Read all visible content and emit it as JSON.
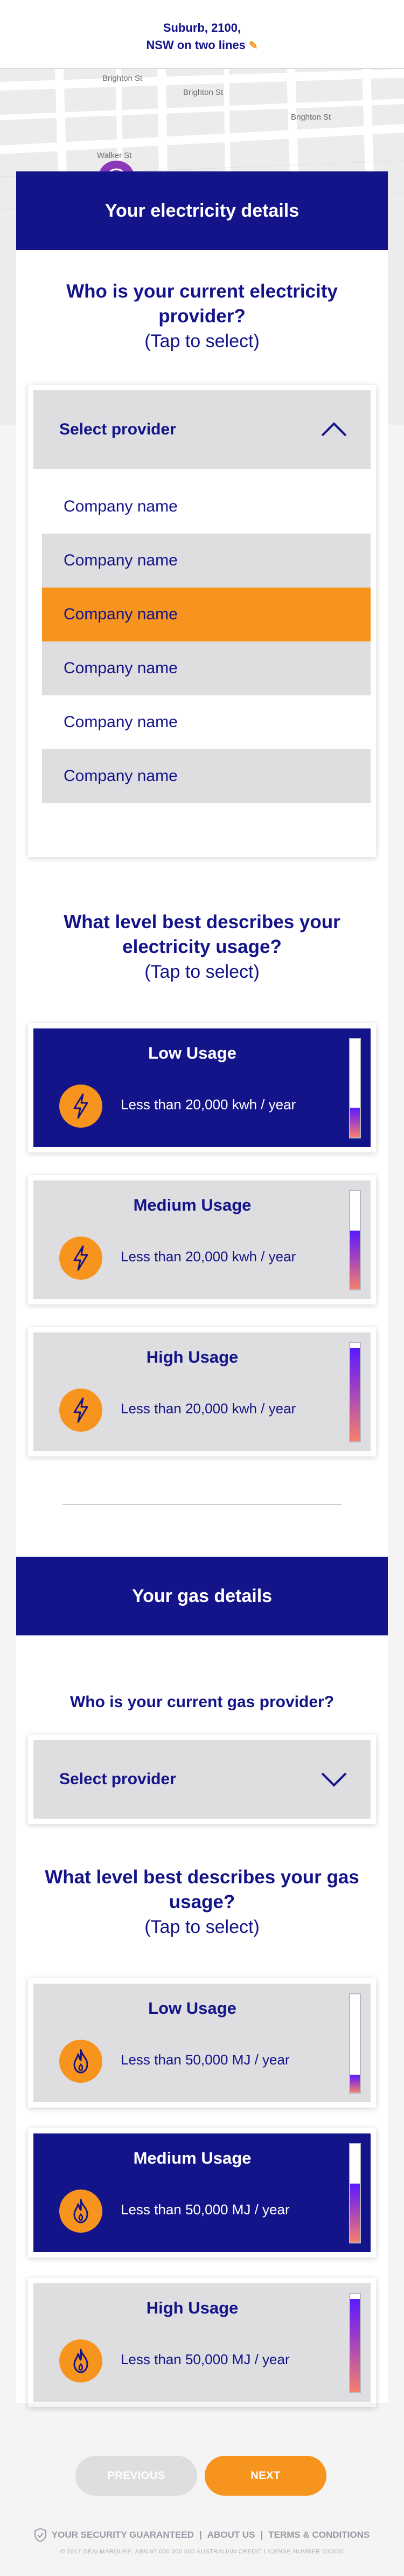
{
  "header": {
    "line1": "Suburb, 2100,",
    "line2": "NSW on two lines",
    "edit_icon": "pencil-icon"
  },
  "map": {
    "streets": [
      "Brighton St",
      "Brighton St",
      "Brighton St",
      "Walker St"
    ]
  },
  "electricity": {
    "section_title": "Your electricity details",
    "provider_question": "Who is your current electricity provider?",
    "provider_hint": "(Tap to select)",
    "select_label": "Select provider",
    "options": [
      "Company name",
      "Company name",
      "Company name",
      "Company name",
      "Company name",
      "Company name"
    ],
    "selected_index": 2,
    "usage_question": "What level best describes your electricity usage?",
    "usage_hint": "(Tap to select)",
    "usage": [
      {
        "title": "Low Usage",
        "desc": "Less than 20,000 kwh / year",
        "level": 0.3,
        "active": true
      },
      {
        "title": "Medium Usage",
        "desc": "Less than 20,000 kwh / year",
        "level": 0.6,
        "active": false
      },
      {
        "title": "High Usage",
        "desc": "Less than 20,000 kwh / year",
        "level": 0.95,
        "active": false
      }
    ]
  },
  "gas": {
    "section_title": "Your gas details",
    "provider_question": "Who is your current gas provider?",
    "select_label": "Select provider",
    "usage_question": "What level best describes your gas usage?",
    "usage_hint": "(Tap to select)",
    "usage": [
      {
        "title": "Low Usage",
        "desc": "Less than 50,000 MJ / year",
        "level": 0.18,
        "active": false
      },
      {
        "title": "Medium Usage",
        "desc": "Less than 50,000 MJ / year",
        "level": 0.6,
        "active": true
      },
      {
        "title": "High Usage",
        "desc": "Less than 50,000 MJ / year",
        "level": 0.95,
        "active": false
      }
    ]
  },
  "nav": {
    "prev_label": "PREVIOUS",
    "next_label": "NEXT"
  },
  "footer": {
    "security": "YOUR SECURITY GUARANTEED",
    "about": "ABOUT US",
    "terms": "TERMS & CONDITIONS",
    "separator": "|",
    "legal": "© 2017 DEALMARQUEE, ABN 87 000 000 000 AUSTRALIAN CREDIT LICENSE NUMBER 000000"
  },
  "colors": {
    "navy": "#14148a",
    "orange": "#f7941d",
    "grey": "#dedddf",
    "pin": "#8a3ab9"
  }
}
